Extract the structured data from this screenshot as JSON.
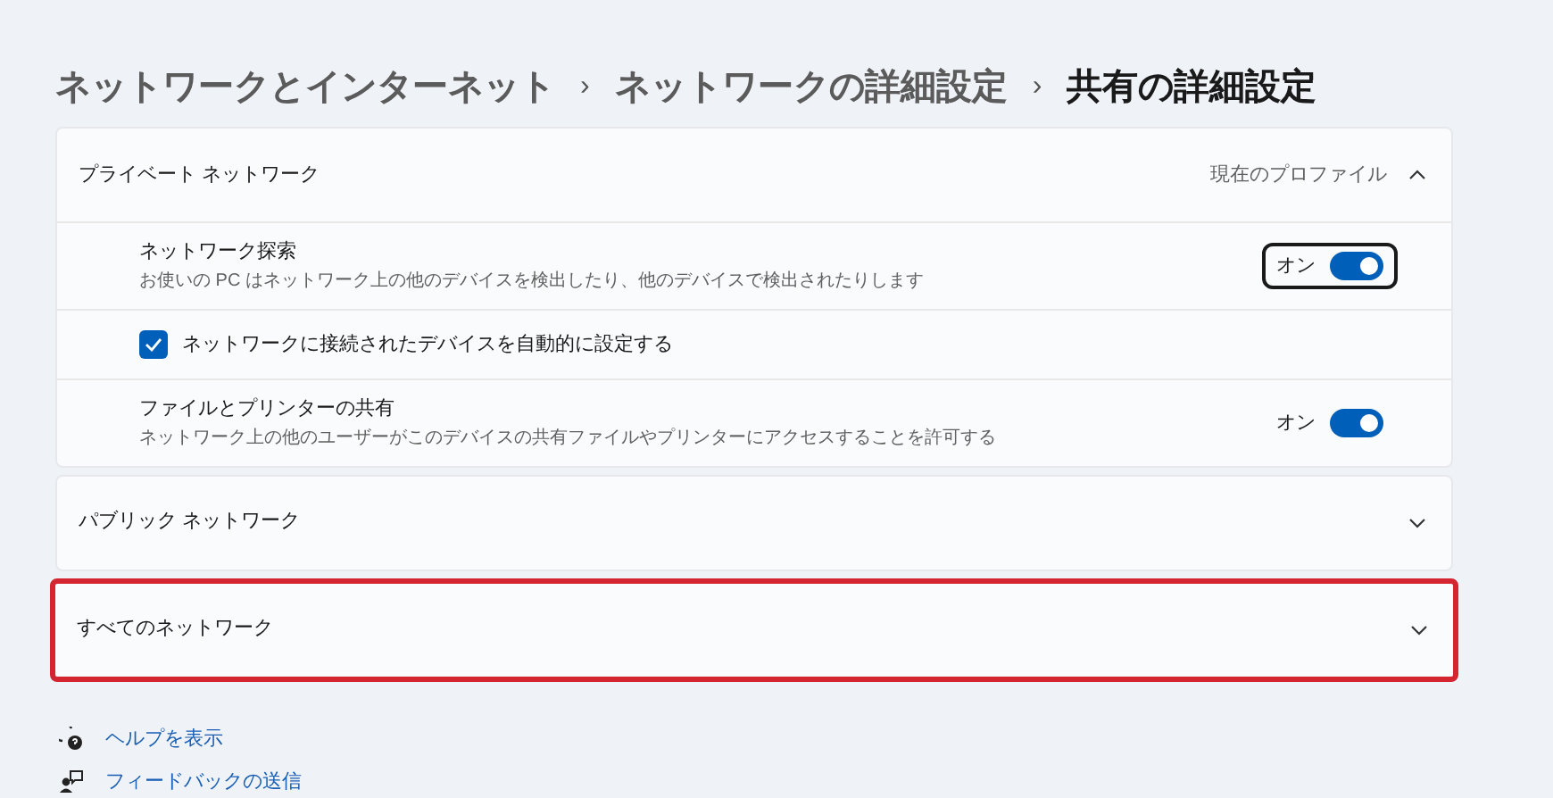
{
  "breadcrumb": [
    {
      "label": "ネットワークとインターネット",
      "current": false
    },
    {
      "label": "ネットワークの詳細設定",
      "current": false
    },
    {
      "label": "共有の詳細設定",
      "current": true
    }
  ],
  "breadcrumb_separator": "›",
  "sections": [
    {
      "title": "プライベート ネットワーク",
      "badge": "現在のプロファイル",
      "expanded": true,
      "highlighted": false,
      "items": [
        {
          "kind": "toggle",
          "title": "ネットワーク探索",
          "description": "お使いの PC はネットワーク上の他のデバイスを検出したり、他のデバイスで検出されたりします",
          "state_label": "オン",
          "on": true,
          "focused": true
        },
        {
          "kind": "checkbox",
          "title": "ネットワークに接続されたデバイスを自動的に設定する",
          "checked": true
        },
        {
          "kind": "toggle",
          "title": "ファイルとプリンターの共有",
          "description": "ネットワーク上の他のユーザーがこのデバイスの共有ファイルやプリンターにアクセスすることを許可する",
          "state_label": "オン",
          "on": true,
          "focused": false
        }
      ]
    },
    {
      "title": "パブリック ネットワーク",
      "expanded": false,
      "highlighted": false
    },
    {
      "title": "すべてのネットワーク",
      "expanded": false,
      "highlighted": true
    }
  ],
  "links": [
    {
      "kind": "help",
      "label": "ヘルプを表示"
    },
    {
      "kind": "feedback",
      "label": "フィードバックの送信"
    }
  ]
}
